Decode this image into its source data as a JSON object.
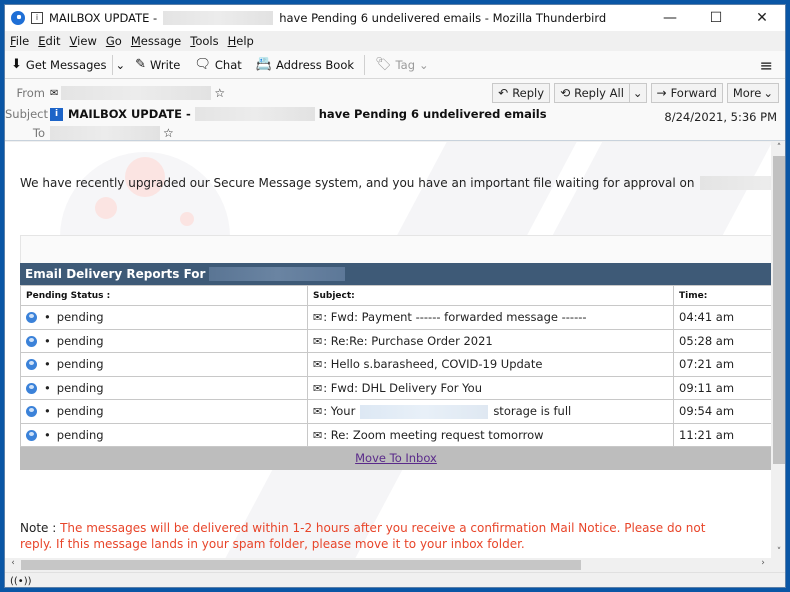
{
  "window": {
    "title_prefix": "MAILBOX UPDATE -",
    "title_suffix": "have Pending 6 undelivered emails - Mozilla Thunderbird",
    "controls": {
      "minimize": "—",
      "maximize": "☐",
      "close": "✕"
    }
  },
  "menu": [
    {
      "label": "File",
      "key": "F",
      "rest": "ile"
    },
    {
      "label": "Edit",
      "key": "E",
      "rest": "dit"
    },
    {
      "label": "View",
      "key": "V",
      "rest": "iew"
    },
    {
      "label": "Go",
      "key": "G",
      "rest": "o"
    },
    {
      "label": "Message",
      "key": "M",
      "rest": "essage"
    },
    {
      "label": "Tools",
      "key": "T",
      "rest": "ools"
    },
    {
      "label": "Help",
      "key": "H",
      "rest": "elp"
    }
  ],
  "toolbar": {
    "get_messages": "Get Messages",
    "write": "Write",
    "chat": "Chat",
    "address_book": "Address Book",
    "tag": "Tag"
  },
  "header": {
    "from_label": "From",
    "subject_label": "Subject",
    "to_label": "To",
    "subject_prefix": "MAILBOX UPDATE -",
    "subject_suffix": "have Pending 6 undelivered emails",
    "date": "8/24/2021, 5:36 PM",
    "buttons": {
      "reply": "Reply",
      "reply_all": "Reply All",
      "forward": "Forward",
      "more": "More"
    }
  },
  "body": {
    "intro": "We have recently upgraded our Secure Message system, and you have an important file waiting for approval on",
    "report_title": "Email Delivery Reports For",
    "columns": [
      "Pending Status :",
      "Subject:",
      "Time:"
    ],
    "rows": [
      {
        "status": "pending",
        "subject": ": Fwd: Payment ------ forwarded message ------",
        "subject_tail": "",
        "time": "04:41 am"
      },
      {
        "status": "pending",
        "subject": ": Re:Re: Purchase Order 2021",
        "subject_tail": "",
        "time": "05:28 am"
      },
      {
        "status": "pending",
        "subject": ": Hello s.barasheed, COVID-19 Update",
        "subject_tail": "",
        "time": "07:21 am"
      },
      {
        "status": "pending",
        "subject": ": Fwd: DHL Delivery For You",
        "subject_tail": "",
        "time": "09:11 am"
      },
      {
        "status": "pending",
        "subject": ": Your",
        "subject_tail": "storage is full",
        "time": "09:54 am"
      },
      {
        "status": "pending",
        "subject": ": Re: Zoom meeting request tomorrow",
        "subject_tail": "",
        "time": "11:21 am"
      }
    ],
    "move_link": "Move To Inbox",
    "note_label": "Note :",
    "note_text": "The messages will be delivered within 1-2 hours after you receive a confirmation Mail Notice. Please do not reply. If this message lands in your spam folder, please move it to your inbox folder."
  },
  "colors": {
    "report_header": "#3e5a77",
    "note": "#e8452a",
    "link": "#5a2a8a",
    "accent": "#1c64c8"
  }
}
